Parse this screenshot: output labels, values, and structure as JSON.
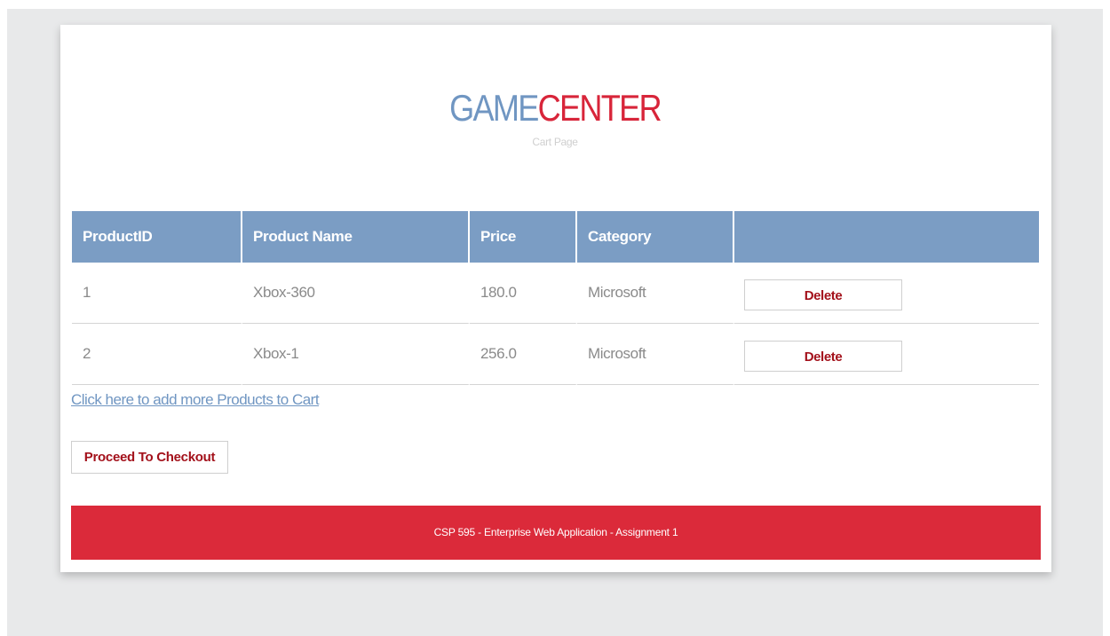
{
  "header": {
    "logo_part1": "GAME",
    "logo_part2": "CENTER",
    "subtitle": "Cart Page"
  },
  "table": {
    "columns": [
      "ProductID",
      "Product Name",
      "Price",
      "Category",
      ""
    ],
    "rows": [
      {
        "id": "1",
        "name": "Xbox-360",
        "price": "180.0",
        "category": "Microsoft",
        "action": "Delete"
      },
      {
        "id": "2",
        "name": "Xbox-1",
        "price": "256.0",
        "category": "Microsoft",
        "action": "Delete"
      }
    ]
  },
  "add_link": "Click here to add more Products to Cart",
  "checkout_label": "Proceed To Checkout",
  "footer": {
    "text": "CSP 595 - Enterprise Web Application - Assignment 1"
  },
  "colors": {
    "logo_blue": "#7096c2",
    "logo_red": "#d8253a",
    "header_bg": "#7b9dc4",
    "footer_bg": "#db2a3a",
    "button_text": "#a3111b"
  }
}
